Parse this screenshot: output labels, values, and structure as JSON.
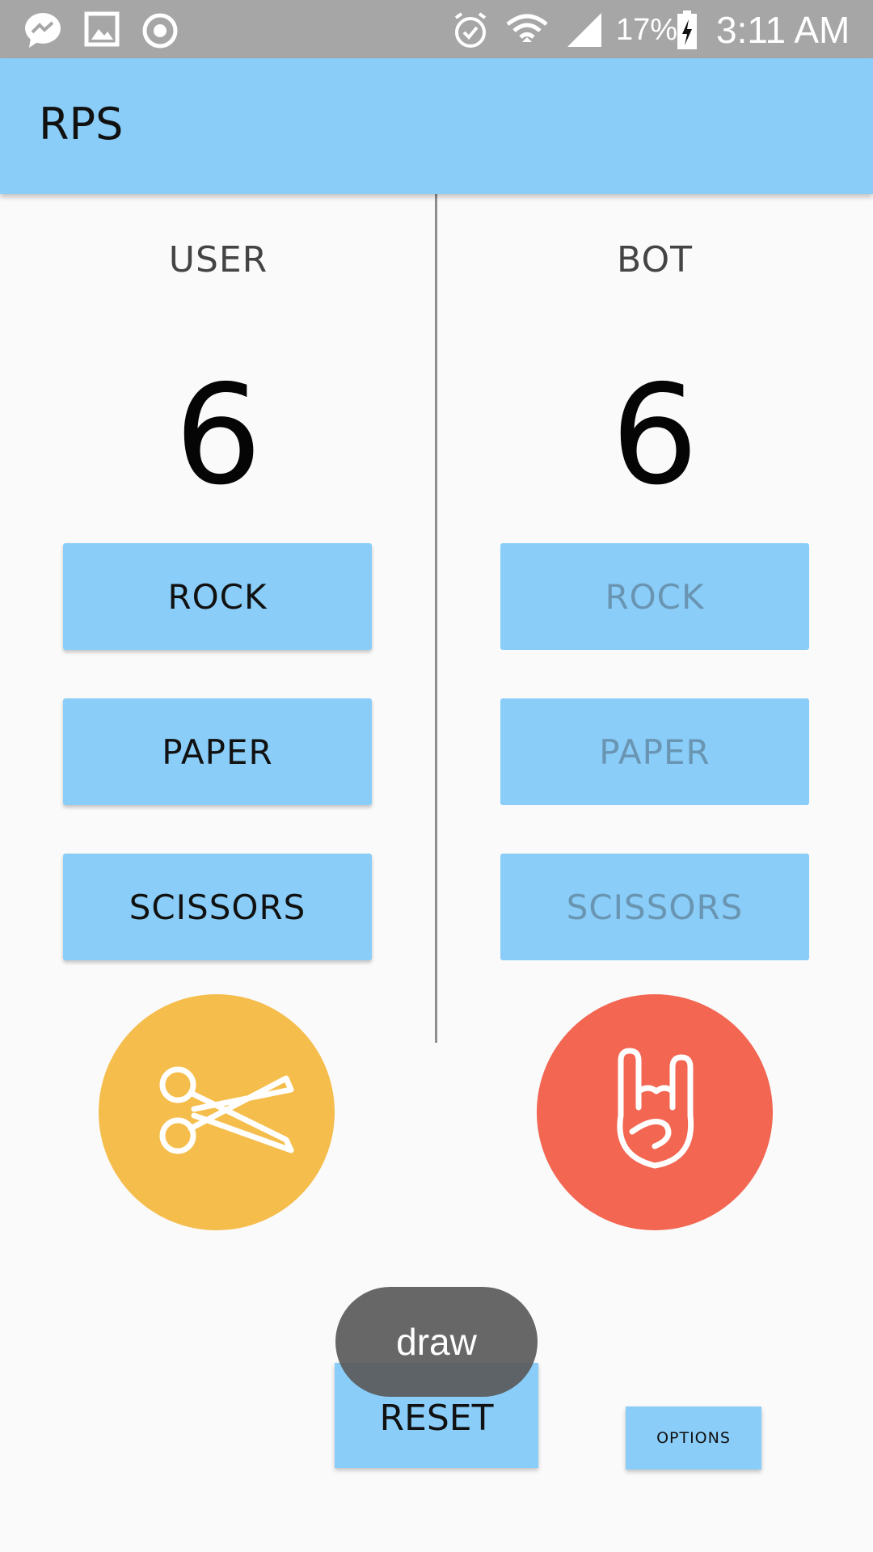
{
  "status_bar": {
    "battery": "17%",
    "time": "3:11 AM",
    "left_icons": [
      "messenger-icon",
      "gallery-icon",
      "sync-icon"
    ],
    "right_icons": [
      "alarm-icon",
      "wifi-icon",
      "signal-icon",
      "battery-charging-icon"
    ]
  },
  "app_bar": {
    "title": "RPS",
    "color": "#89cdf8"
  },
  "user": {
    "label": "USER",
    "score": "6",
    "buttons": [
      "ROCK",
      "PAPER",
      "SCISSORS"
    ],
    "choice_icon": "scissors-icon",
    "choice_color": "#f5bd4c"
  },
  "bot": {
    "label": "BOT",
    "score": "6",
    "buttons": [
      "ROCK",
      "PAPER",
      "SCISSORS"
    ],
    "choice_icon": "rock-hand-icon",
    "choice_color": "#f26652"
  },
  "reset_label": "RESET",
  "options_label": "OPTIONS",
  "toast": "draw"
}
